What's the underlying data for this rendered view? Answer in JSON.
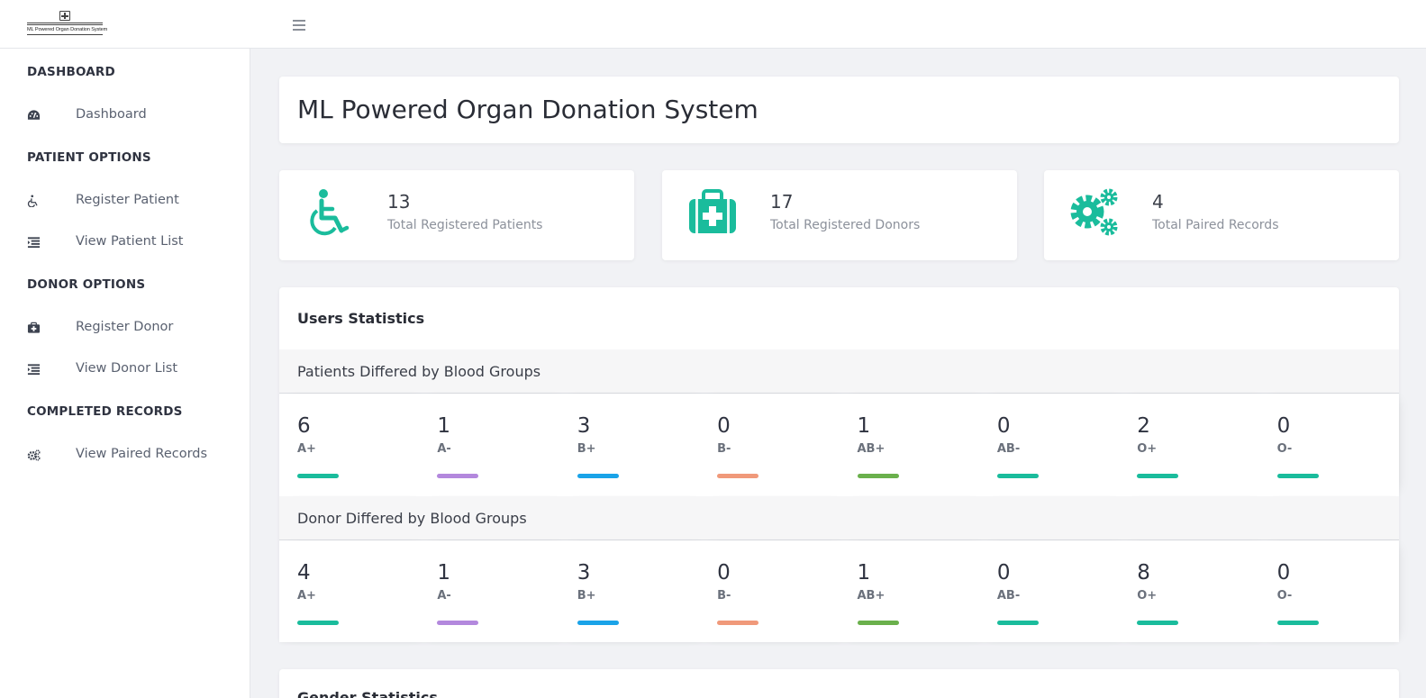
{
  "app": {
    "logo_text": "ML Powered Organ Donation System"
  },
  "sidebar": {
    "sections": [
      {
        "heading": "DASHBOARD",
        "items": [
          {
            "label": "Dashboard",
            "icon": "dashboard-icon"
          }
        ]
      },
      {
        "heading": "PATIENT OPTIONS",
        "items": [
          {
            "label": "Register Patient",
            "icon": "wheelchair-icon"
          },
          {
            "label": "View Patient List",
            "icon": "list-icon"
          }
        ]
      },
      {
        "heading": "DONOR OPTIONS",
        "items": [
          {
            "label": "Register Donor",
            "icon": "medkit-icon"
          },
          {
            "label": "View Donor List",
            "icon": "list-icon"
          }
        ]
      },
      {
        "heading": "COMPLETED RECORDS",
        "items": [
          {
            "label": "View Paired Records",
            "icon": "gears-icon"
          }
        ]
      }
    ]
  },
  "main": {
    "title": "ML Powered Organ Donation System",
    "stats": [
      {
        "value": "13",
        "label": "Total Registered Patients",
        "icon": "wheelchair-icon"
      },
      {
        "value": "17",
        "label": "Total Registered Donors",
        "icon": "medkit-icon"
      },
      {
        "value": "4",
        "label": "Total Paired Records",
        "icon": "gears-icon"
      }
    ],
    "users_statistics": {
      "title": "Users Statistics",
      "patients": {
        "title": "Patients Differed by Blood Groups",
        "groups": [
          {
            "value": "6",
            "group": "A+",
            "color": "#1abc9c"
          },
          {
            "value": "1",
            "group": "A-",
            "color": "#b388dd"
          },
          {
            "value": "3",
            "group": "B+",
            "color": "#1aa3e8"
          },
          {
            "value": "0",
            "group": "B-",
            "color": "#f0997a"
          },
          {
            "value": "1",
            "group": "AB+",
            "color": "#6ab04c"
          },
          {
            "value": "0",
            "group": "AB-",
            "color": "#1abc9c"
          },
          {
            "value": "2",
            "group": "O+",
            "color": "#1abc9c"
          },
          {
            "value": "0",
            "group": "O-",
            "color": "#1abc9c"
          }
        ]
      },
      "donors": {
        "title": "Donor Differed by Blood Groups",
        "groups": [
          {
            "value": "4",
            "group": "A+",
            "color": "#1abc9c"
          },
          {
            "value": "1",
            "group": "A-",
            "color": "#b388dd"
          },
          {
            "value": "3",
            "group": "B+",
            "color": "#1aa3e8"
          },
          {
            "value": "0",
            "group": "B-",
            "color": "#f0997a"
          },
          {
            "value": "1",
            "group": "AB+",
            "color": "#6ab04c"
          },
          {
            "value": "0",
            "group": "AB-",
            "color": "#1abc9c"
          },
          {
            "value": "8",
            "group": "O+",
            "color": "#1abc9c"
          },
          {
            "value": "0",
            "group": "O-",
            "color": "#1abc9c"
          }
        ]
      }
    },
    "next_section_title": "Gender Statistics"
  },
  "colors": {
    "accent": "#1abc9c"
  }
}
